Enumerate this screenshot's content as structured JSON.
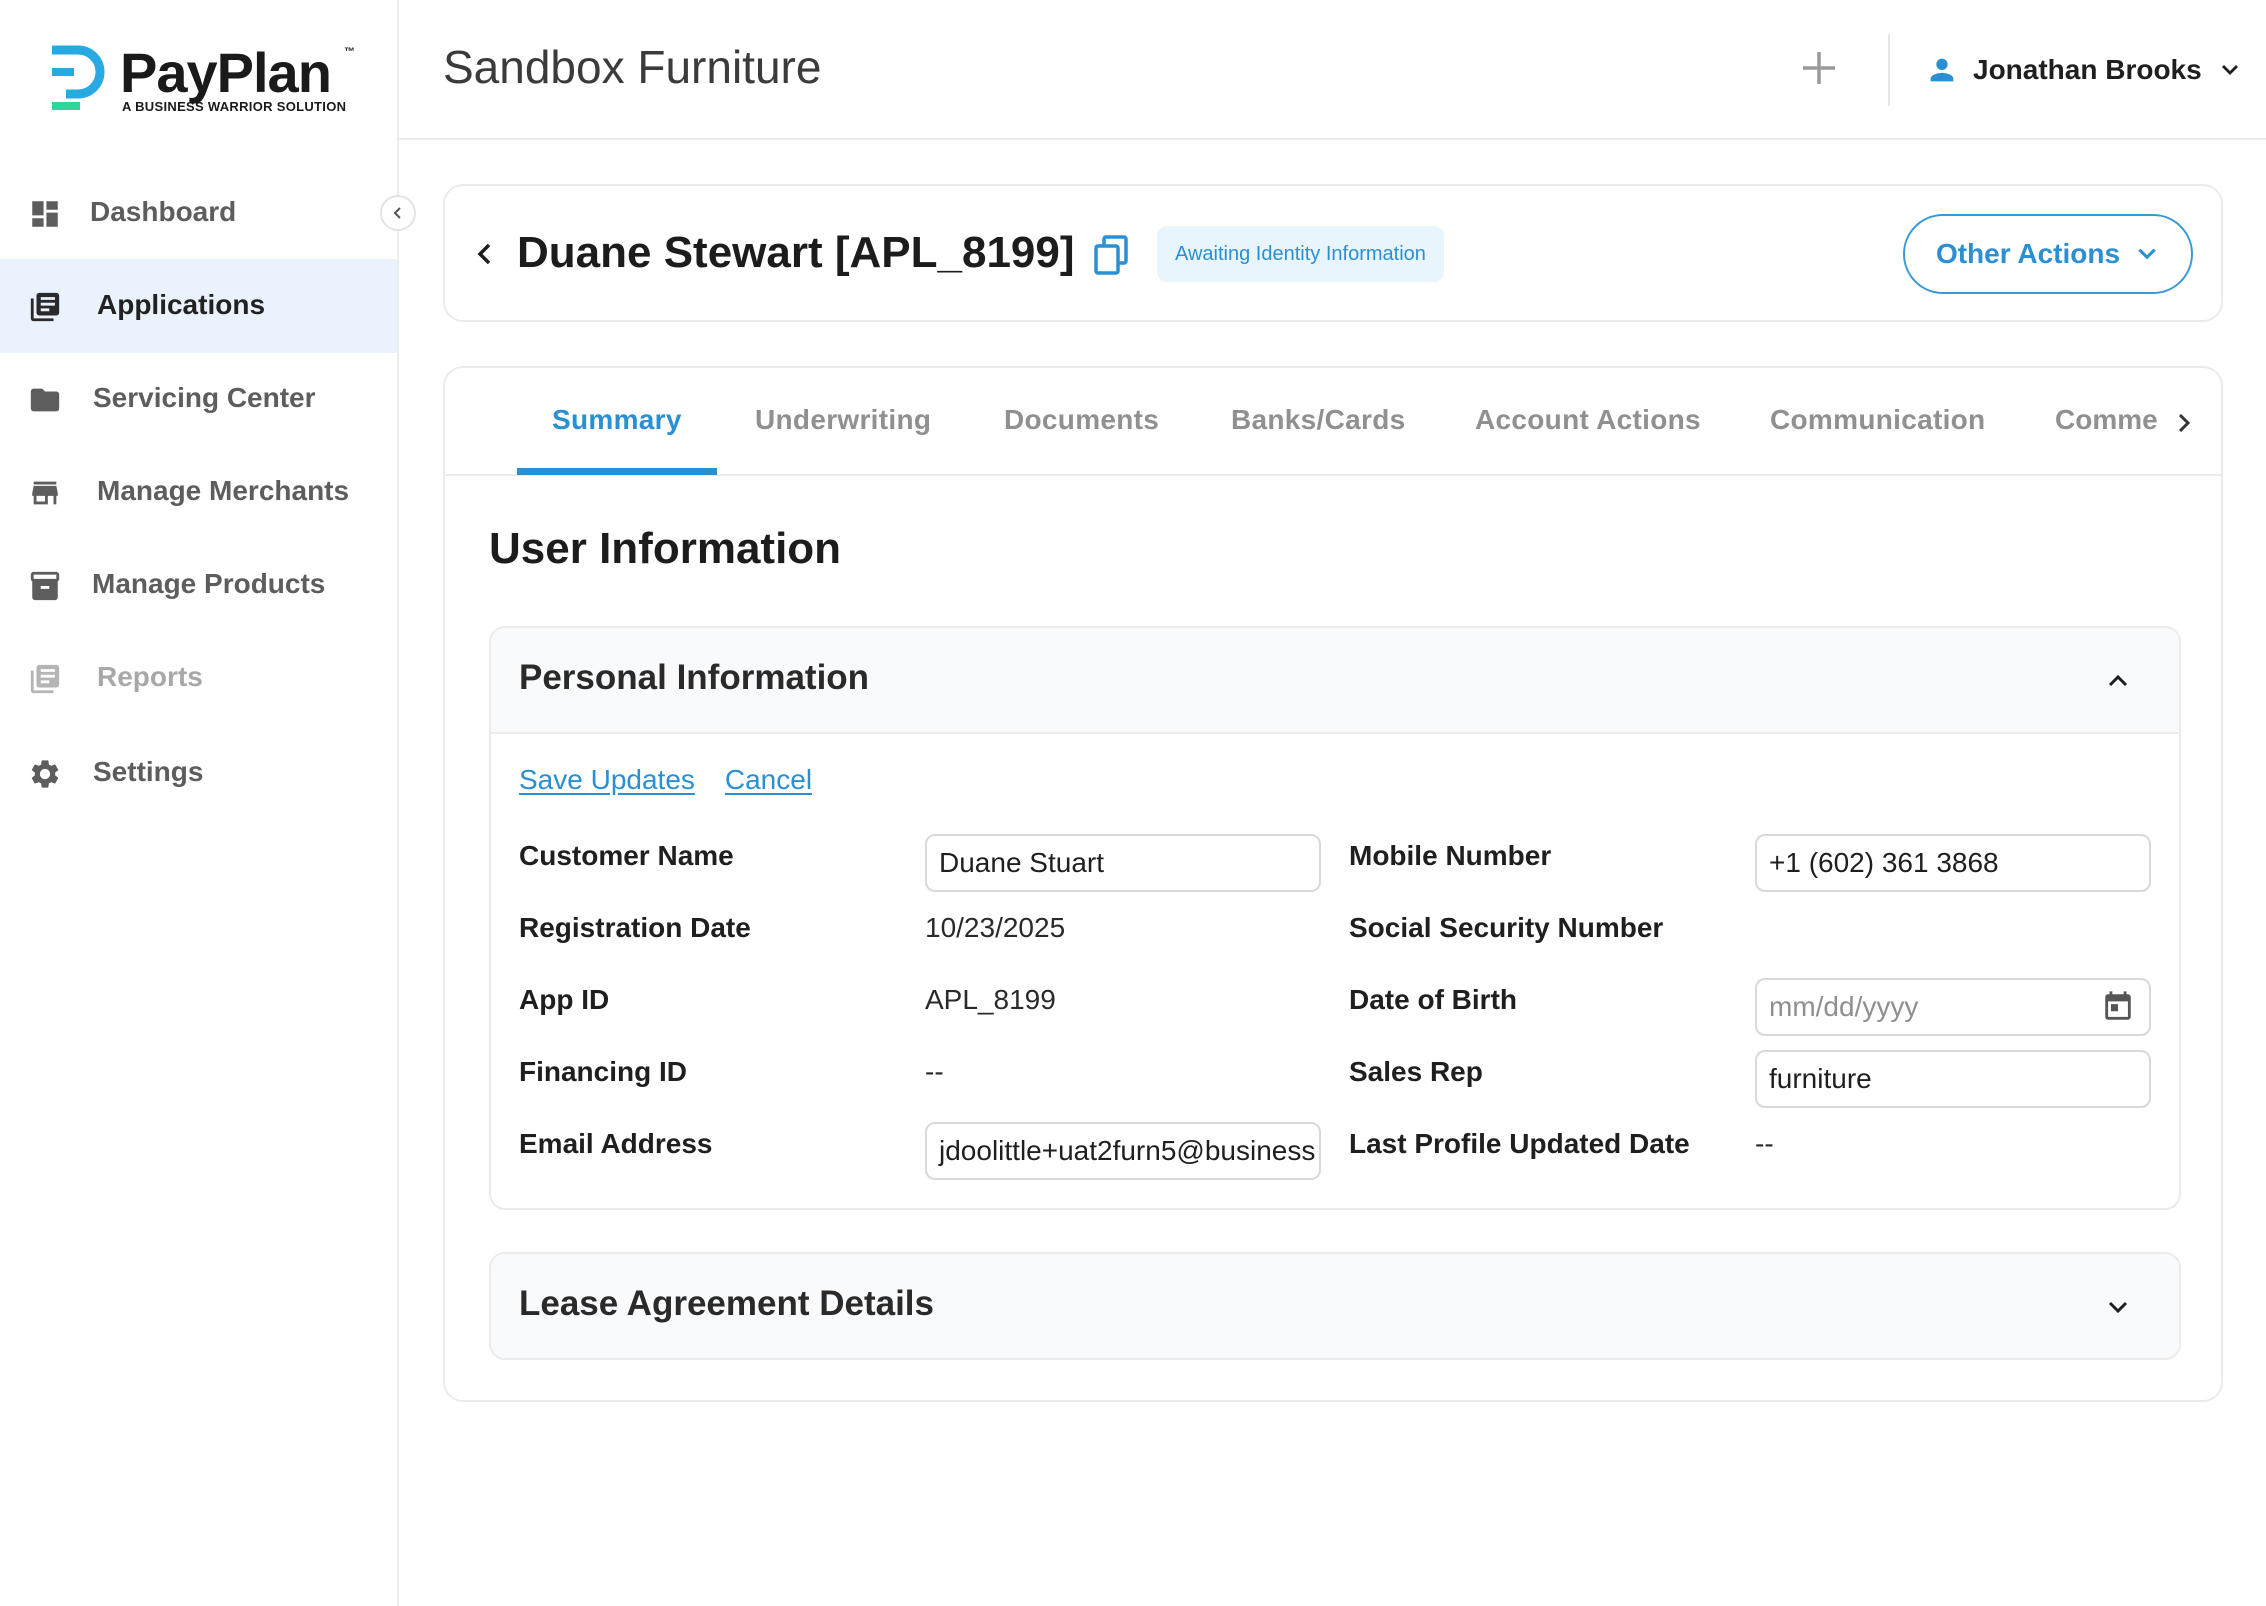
{
  "brand": {
    "name": "PayPlan",
    "trademark": "™",
    "tagline": "A BUSINESS WARRIOR SOLUTION",
    "colors": {
      "primary": "#2a8fd3",
      "logo_blue": "#27a9e1",
      "logo_green": "#2fd59a",
      "active_nav_bg": "#eaf2fd"
    }
  },
  "sidebar": {
    "items": [
      {
        "label": "Dashboard",
        "icon": "dashboard-icon",
        "state": "normal"
      },
      {
        "label": "Applications",
        "icon": "applications-icon",
        "state": "active"
      },
      {
        "label": "Servicing Center",
        "icon": "folder-icon",
        "state": "normal"
      },
      {
        "label": "Manage Merchants",
        "icon": "storefront-icon",
        "state": "normal"
      },
      {
        "label": "Manage Products",
        "icon": "archive-box-icon",
        "state": "normal"
      },
      {
        "label": "Reports",
        "icon": "reports-icon",
        "state": "disabled"
      },
      {
        "label": "Settings",
        "icon": "gear-icon",
        "state": "normal"
      }
    ]
  },
  "header": {
    "company": "Sandbox Furniture",
    "user_name": "Jonathan Brooks"
  },
  "application": {
    "title": "Duane Stewart [APL_8199]",
    "status": "Awaiting Identity Information",
    "other_actions_label": "Other Actions"
  },
  "tabs": [
    {
      "label": "Summary",
      "active": true
    },
    {
      "label": "Underwriting"
    },
    {
      "label": "Documents"
    },
    {
      "label": "Banks/Cards"
    },
    {
      "label": "Account Actions"
    },
    {
      "label": "Communication"
    },
    {
      "label": "Comme"
    }
  ],
  "section_title": "User Information",
  "personal_info": {
    "title": "Personal Information",
    "save_label": "Save Updates",
    "cancel_label": "Cancel",
    "fields": {
      "customer_name": {
        "label": "Customer Name",
        "value": "Duane Stuart"
      },
      "registration_date": {
        "label": "Registration Date",
        "value": "10/23/2025"
      },
      "app_id": {
        "label": "App ID",
        "value": "APL_8199"
      },
      "financing_id": {
        "label": "Financing ID",
        "value": "--"
      },
      "email": {
        "label": "Email Address",
        "value": "jdoolittle+uat2furn5@business"
      },
      "mobile": {
        "label": "Mobile Number",
        "value": "+1 (602) 361 3868"
      },
      "ssn": {
        "label": "Social Security Number",
        "value": ""
      },
      "dob": {
        "label": "Date of Birth",
        "placeholder": "mm/dd/yyyy"
      },
      "sales_rep": {
        "label": "Sales Rep",
        "value": "furniture"
      },
      "last_updated": {
        "label": "Last Profile Updated Date",
        "value": "--"
      }
    }
  },
  "lease_panel": {
    "title": "Lease Agreement Details"
  }
}
